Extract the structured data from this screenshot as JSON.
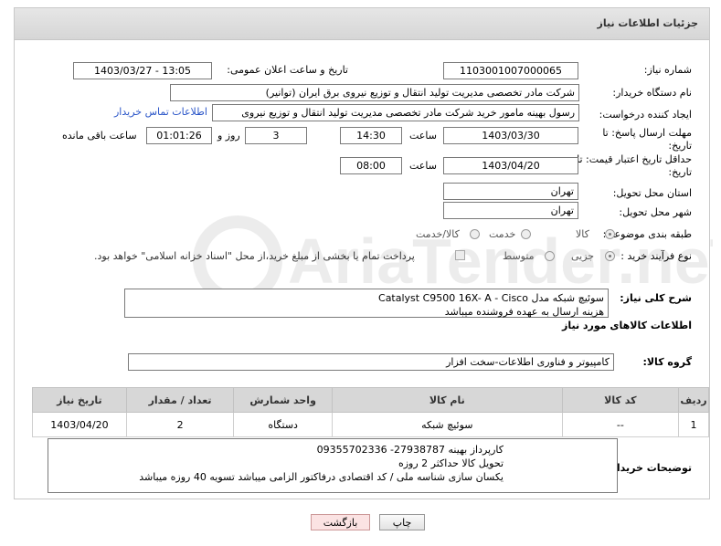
{
  "header": {
    "title": "جزئیات اطلاعات نیاز"
  },
  "fields": {
    "need_number_label": "شماره نیاز:",
    "need_number": "1103001007000065",
    "announce_label": "تاریخ و ساعت اعلان عمومی:",
    "announce_value": "1403/03/27 - 13:05",
    "buyer_label": "نام دستگاه خریدار:",
    "buyer_value": "شرکت مادر تخصصی مدیریت تولید  انتقال و توزیع نیروی برق ایران (توانیر)",
    "creator_label": "ایجاد کننده درخواست:",
    "creator_value": "رسول بهینه مامور خرید شرکت مادر تخصصی مدیریت تولید  انتقال و توزیع نیروی",
    "contact_link": "اطلاعات تماس خریدار",
    "deadline_label": "مهلت ارسال پاسخ: تا تاریخ:",
    "deadline_date": "1403/03/30",
    "time_label": "ساعت",
    "deadline_time": "14:30",
    "days_value": "3",
    "days_label": "روز و",
    "remaining_value": "01:01:26",
    "remaining_label": "ساعت باقی مانده",
    "price_validity_label": "حداقل تاریخ اعتبار قیمت: تا تاریخ:",
    "price_validity_date": "1403/04/20",
    "price_validity_time": "08:00",
    "province_label": "استان محل تحویل:",
    "province_value": "تهران",
    "city_label": "شهر محل تحویل:",
    "city_value": "تهران",
    "category_label": "طبقه بندی موضوعی:",
    "category_options": [
      "کالا",
      "خدمت",
      "کالا/خدمت"
    ],
    "process_label": "نوع فرآیند خرید :",
    "process_options": [
      "جزیی",
      "متوسط"
    ],
    "payment_note": "پرداخت تمام یا بخشی از مبلغ خرید،از محل \"اسناد خزانه اسلامی\" خواهد بود."
  },
  "description": {
    "label": "شرح کلی نیاز:",
    "line1": "سوئیچ شبکه  مدل Catalyst  C9500  16X- A  - Cisco",
    "line2": "هزینه ارسال به عهده فروشنده میباشد"
  },
  "goods_section": {
    "title": "اطلاعات کالاهای مورد نیاز",
    "group_label": "گروه کالا:",
    "group_value": "کامپیوتر و فناوری اطلاعات-سخت افزار"
  },
  "table": {
    "headers": [
      "ردیف",
      "کد کالا",
      "نام کالا",
      "واحد شمارش",
      "تعداد / مقدار",
      "تاریخ نیاز"
    ],
    "rows": [
      [
        "1",
        "--",
        "سوئیچ شبکه",
        "دستگاه",
        "2",
        "1403/04/20"
      ]
    ]
  },
  "buyer_notes": {
    "label": "توضیحات خریدار:",
    "line1": "کارپرداز بهینه 27938787-  09355702336",
    "line2": "تحویل کالا حداکثر 2 روزه",
    "line3": "یکسان سازی شناسه ملی / کد اقتصادی درفاکتور الزامی میباشد     تسویه 40 روزه میباشد"
  },
  "buttons": {
    "print": "چاپ",
    "back": "بازگشت"
  },
  "watermark_text": "AriaTender.neT"
}
